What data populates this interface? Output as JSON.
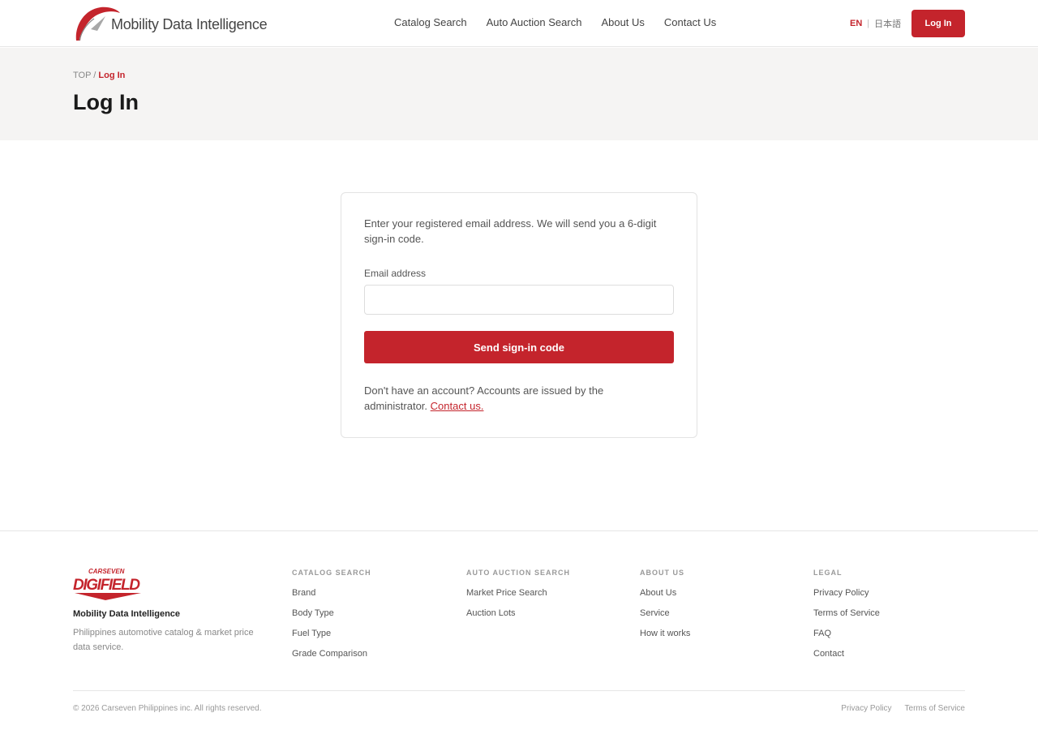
{
  "header": {
    "logo_text": "Mobility Data Intelligence",
    "nav": [
      {
        "label": "Catalog Search"
      },
      {
        "label": "Auto Auction Search"
      },
      {
        "label": "About Us"
      },
      {
        "label": "Contact Us"
      }
    ],
    "lang_en": "EN",
    "lang_ja": "日本語",
    "login_label": "Log In"
  },
  "breadcrumb": {
    "root": "TOP",
    "separator": "/",
    "current": "Log In"
  },
  "page_title": "Log In",
  "login_card": {
    "intro": "Enter your registered email address. We will send you a 6-digit sign-in code.",
    "email_label": "Email address",
    "email_value": "",
    "email_placeholder": "",
    "send_button": "Send sign-in code",
    "note_text": "Don't have an account? Accounts are issued by the administrator.",
    "contact_link": "Contact us."
  },
  "footer": {
    "logo_top": "CARSEVEN",
    "logo_main": "DIGIFIELD",
    "brand": "Mobility Data Intelligence",
    "description": "Philippines automotive catalog & market price data service.",
    "columns": [
      {
        "title": "CATALOG SEARCH",
        "links": [
          "Brand",
          "Body Type",
          "Fuel Type",
          "Grade Comparison"
        ]
      },
      {
        "title": "AUTO AUCTION SEARCH",
        "links": [
          "Market Price Search",
          "Auction Lots"
        ]
      },
      {
        "title": "ABOUT US",
        "links": [
          "About Us",
          "Service",
          "How it works"
        ]
      },
      {
        "title": "LEGAL",
        "links": [
          "Privacy Policy",
          "Terms of Service",
          "FAQ",
          "Contact"
        ]
      }
    ],
    "copyright": "© 2026 Carseven Philippines inc. All rights reserved.",
    "bottom_links": [
      "Privacy Policy",
      "Terms of Service"
    ]
  },
  "colors": {
    "accent": "#c4242c",
    "band_bg": "#f5f4f3"
  }
}
